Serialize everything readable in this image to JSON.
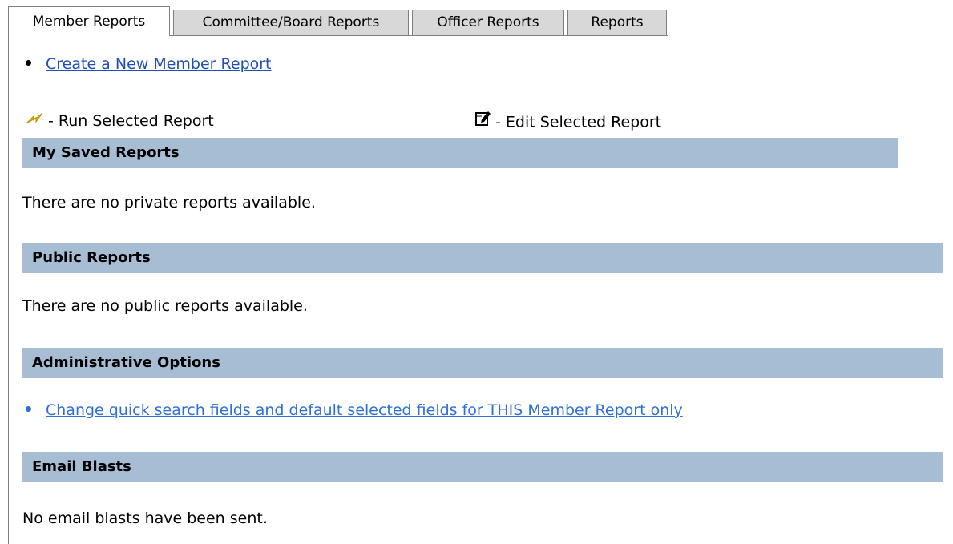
{
  "tabs": [
    {
      "label": "Member Reports",
      "active": true
    },
    {
      "label": "Committee/Board Reports",
      "active": false
    },
    {
      "label": "Officer Reports",
      "active": false
    },
    {
      "label": "Reports",
      "active": false
    }
  ],
  "create_link": "Create a New Member Report",
  "legend": {
    "run_label": "- Run Selected Report",
    "run_icon": "run-lightning-icon",
    "edit_label": "- Edit Selected Report",
    "edit_icon": "edit-note-icon"
  },
  "sections": {
    "saved": {
      "title": "My Saved Reports",
      "message": "There are no private reports available."
    },
    "public": {
      "title": "Public Reports",
      "message": "There are no public reports available."
    },
    "admin": {
      "title": "Administrative Options",
      "link": "Change quick search fields and default selected fields for THIS Member Report only"
    },
    "email": {
      "title": "Email Blasts",
      "message": "No email blasts have been sent."
    }
  },
  "colors": {
    "section_bar": "#a6bdd4",
    "link": "#1f4fb3",
    "tab_inactive": "#d8d8d8"
  }
}
